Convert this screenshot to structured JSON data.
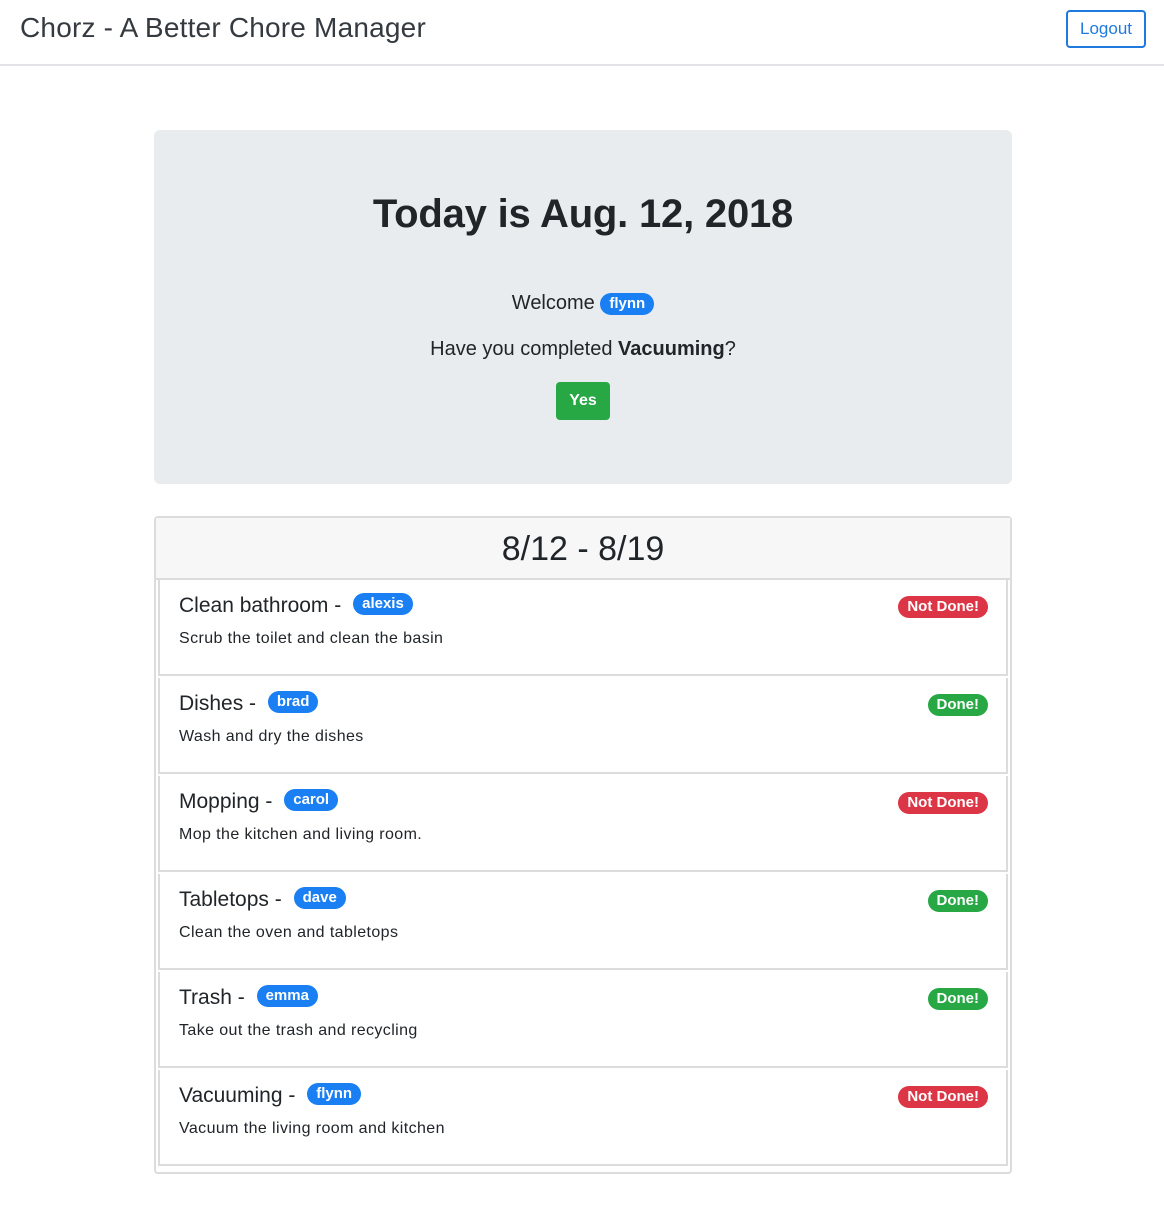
{
  "navbar": {
    "brand": "Chorz - A Better Chore Manager",
    "logout_label": "Logout"
  },
  "jumbotron": {
    "title": "Today is Aug. 12, 2018",
    "welcome_prefix": "Welcome",
    "username": "flynn",
    "question_prefix": "Have you completed",
    "question_chore": "Vacuuming",
    "question_suffix": "?",
    "yes_label": "Yes"
  },
  "week": {
    "range": "8/12 - 8/19",
    "chores": [
      {
        "name": "Clean bathroom",
        "separator": "-",
        "user": "alexis",
        "description": "Scrub the toilet and clean the basin",
        "status": "Not Done!",
        "done": false
      },
      {
        "name": "Dishes",
        "separator": "-",
        "user": "brad",
        "description": "Wash and dry the dishes",
        "status": "Done!",
        "done": true
      },
      {
        "name": "Mopping",
        "separator": "-",
        "user": "carol",
        "description": "Mop the kitchen and living room.",
        "status": "Not Done!",
        "done": false
      },
      {
        "name": "Tabletops",
        "separator": "-",
        "user": "dave",
        "description": "Clean the oven and tabletops",
        "status": "Done!",
        "done": true
      },
      {
        "name": "Trash",
        "separator": "-",
        "user": "emma",
        "description": "Take out the trash and recycling",
        "status": "Done!",
        "done": true
      },
      {
        "name": "Vacuuming",
        "separator": "-",
        "user": "flynn",
        "description": "Vacuum the living room and kitchen",
        "status": "Not Done!",
        "done": false
      }
    ]
  },
  "colors": {
    "primary_badge": "#1a7ff2",
    "danger_badge": "#dc3545",
    "success_badge": "#28a745",
    "jumbotron_bg": "#e9ecef"
  }
}
